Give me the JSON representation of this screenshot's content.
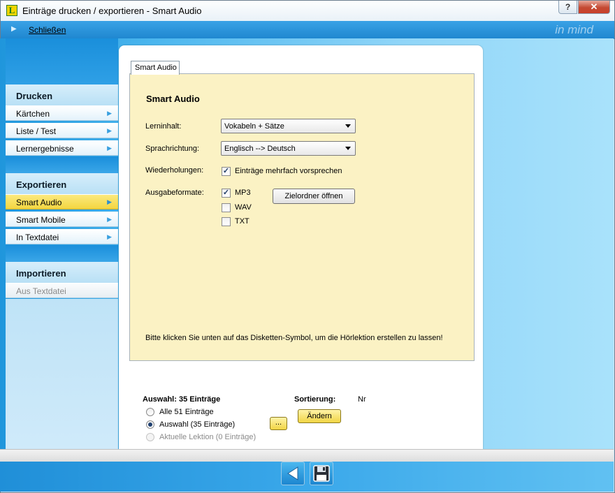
{
  "window": {
    "title": "Einträge drucken / exportieren - Smart Audio",
    "help_glyph": "?",
    "close_glyph": "✕",
    "app_icon_letter": "L"
  },
  "menubar": {
    "close_label": "Schließen",
    "brand": "in mind"
  },
  "nav": {
    "drucken": {
      "title": "Drucken",
      "items": [
        {
          "label": "Kärtchen"
        },
        {
          "label": "Liste / Test"
        },
        {
          "label": "Lernergebnisse"
        }
      ]
    },
    "exportieren": {
      "title": "Exportieren",
      "items": [
        {
          "label": "Smart Audio",
          "active": true
        },
        {
          "label": "Smart Mobile"
        },
        {
          "label": "In Textdatei"
        }
      ]
    },
    "importieren": {
      "title": "Importieren",
      "items": [
        {
          "label": "Aus Textdatei",
          "disabled": true
        }
      ]
    }
  },
  "tab": {
    "label": "Smart Audio"
  },
  "form": {
    "heading": "Smart Audio",
    "lerninhalt": {
      "label": "Lerninhalt:",
      "value": "Vokabeln + Sätze"
    },
    "sprachrichtung": {
      "label": "Sprachrichtung:",
      "value": "Englisch --> Deutsch"
    },
    "wiederholungen": {
      "label": "Wiederholungen:",
      "checkbox_label": "Einträge mehrfach vorsprechen",
      "checked": true
    },
    "ausgabeformate": {
      "label": "Ausgabeformate:",
      "formats": [
        {
          "label": "MP3",
          "checked": true
        },
        {
          "label": "WAV",
          "checked": false
        },
        {
          "label": "TXT",
          "checked": false
        }
      ],
      "folder_button": "Zielordner öffnen"
    },
    "hint": "Bitte klicken Sie unten auf das Disketten-Symbol, um die Hörlektion erstellen zu lassen!"
  },
  "selection": {
    "title": "Auswahl: 35 Einträge",
    "options": [
      {
        "label": "Alle 51 Einträge",
        "selected": false
      },
      {
        "label": "Auswahl (35 Einträge)",
        "selected": true
      },
      {
        "label": "Aktuelle Lektion (0 Einträge)",
        "selected": false,
        "disabled": true
      }
    ],
    "dots_button": "...",
    "sort_label": "Sortierung:",
    "sort_value": "Nr",
    "change_button": "Ändern"
  },
  "footer": {
    "back_icon": "back-arrow-icon",
    "save_icon": "floppy-disk-icon"
  }
}
